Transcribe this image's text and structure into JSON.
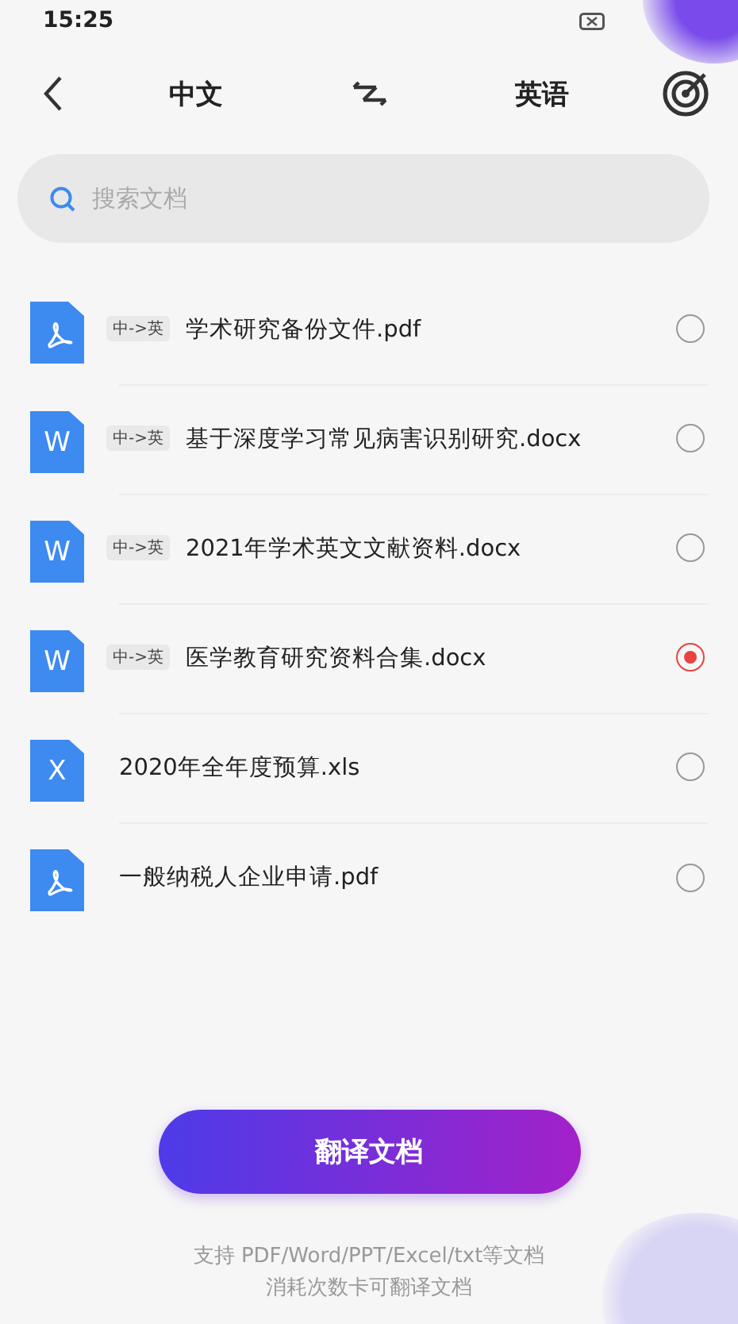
{
  "status_bar": {
    "time": "15:25"
  },
  "header": {
    "source_language": "中文",
    "target_language": "英语"
  },
  "search": {
    "placeholder": "搜索文档"
  },
  "files": [
    {
      "kind": "pdf",
      "badge": "中->英",
      "name": "学术研究备份文件.pdf",
      "selected": false
    },
    {
      "kind": "word",
      "icon_letter": "W",
      "badge": "中->英",
      "name": "基于深度学习常见病害识别研究.docx",
      "selected": false
    },
    {
      "kind": "word",
      "icon_letter": "W",
      "badge": "中->英",
      "name": "2021年学术英文文献资料.docx",
      "selected": false
    },
    {
      "kind": "word",
      "icon_letter": "W",
      "badge": "中->英",
      "name": "医学教育研究资料合集.docx",
      "selected": true
    },
    {
      "kind": "excel",
      "icon_letter": "X",
      "name": "2020年全年度预算.xls",
      "selected": false
    },
    {
      "kind": "pdf",
      "name": "一般纳税人企业申请.pdf",
      "selected": false
    }
  ],
  "action_button": "翻译文档",
  "footer_lines": [
    "支持 PDF/Word/PPT/Excel/txt等文档",
    "消耗次数卡可翻译文档"
  ]
}
